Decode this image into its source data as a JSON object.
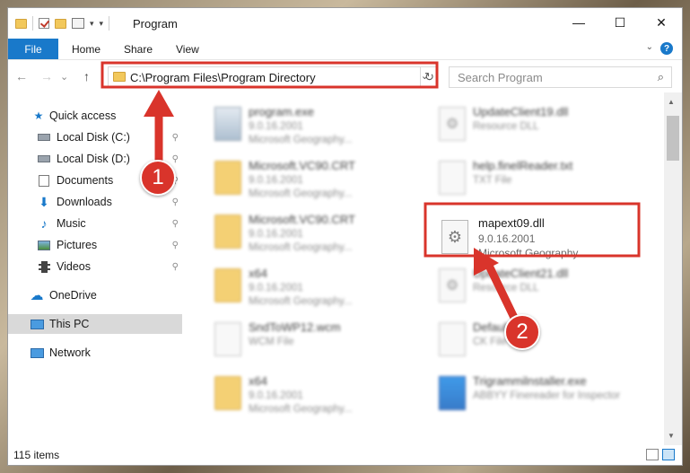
{
  "window": {
    "title": "Program",
    "controls": {
      "minimize": "—",
      "maximize": "☐",
      "close": "✕"
    }
  },
  "ribbon": {
    "tabs": [
      "File",
      "Home",
      "Share",
      "View"
    ],
    "expand_glyph": "⌄",
    "help_glyph": "?"
  },
  "navigation": {
    "back": "←",
    "forward": "→",
    "up": "↑",
    "address_path": "C:\\Program Files\\Program Directory",
    "dropdown_glyph": "⌄",
    "refresh_glyph": "↻",
    "search_placeholder": "Search Program",
    "search_glyph": "⌕"
  },
  "sidebar": {
    "items": [
      {
        "label": "Quick access",
        "icon": "star-icon",
        "pinned": false
      },
      {
        "label": "Local Disk (C:)",
        "icon": "drive-icon",
        "pinned": true
      },
      {
        "label": "Local Disk (D:)",
        "icon": "drive-icon",
        "pinned": true
      },
      {
        "label": "Documents",
        "icon": "documents-icon",
        "pinned": true
      },
      {
        "label": "Downloads",
        "icon": "downloads-icon",
        "pinned": true
      },
      {
        "label": "Music",
        "icon": "music-icon",
        "pinned": true
      },
      {
        "label": "Pictures",
        "icon": "pictures-icon",
        "pinned": true
      },
      {
        "label": "Videos",
        "icon": "videos-icon",
        "pinned": true
      },
      {
        "label": "OneDrive",
        "icon": "cloud-icon",
        "pinned": false
      },
      {
        "label": "This PC",
        "icon": "computer-icon",
        "pinned": false,
        "selected": true
      },
      {
        "label": "Network",
        "icon": "network-icon",
        "pinned": false
      }
    ],
    "pin_glyph": "📌"
  },
  "files": {
    "left_column": [
      {
        "name": "program.exe",
        "line2": "9.0.16.2001",
        "line3": "Microsoft Geography...",
        "icon": "exe"
      },
      {
        "name": "Microsoft.VC90.CRT",
        "line2": "9.0.16.2001",
        "line3": "Microsoft Geography...",
        "icon": "folder"
      },
      {
        "name": "Microsoft.VC90.CRT",
        "line2": "9.0.16.2001",
        "line3": "Microsoft Geography...",
        "icon": "folder"
      },
      {
        "name": "x64",
        "line2": "9.0.16.2001",
        "line3": "Microsoft Geography...",
        "icon": "folder"
      },
      {
        "name": "SndToWP12.wcm",
        "line2": "WCM File",
        "line3": "",
        "icon": "doc"
      },
      {
        "name": "x64",
        "line2": "9.0.16.2001",
        "line3": "Microsoft Geography...",
        "icon": "folder"
      }
    ],
    "right_column": [
      {
        "name": "UpdateClient19.dll",
        "line2": "Resource DLL",
        "line3": "",
        "icon": "dll"
      },
      {
        "name": "help.finelReader.txt",
        "line2": "TXT File",
        "line3": "",
        "icon": "doc"
      },
      {
        "name": "UpdateClient21.dll",
        "line2": "Resource DLL",
        "line3": "",
        "icon": "dll"
      },
      {
        "name": "Default.ck",
        "line2": "CK File",
        "line3": "",
        "icon": "doc"
      },
      {
        "name": "Trigrammilnstaller.exe",
        "line2": "ABBYY Finereader for Inspector",
        "line3": "",
        "icon": "exe-blue"
      }
    ],
    "highlighted": {
      "name": "mapext09.dll",
      "line2": "9.0.16.2001",
      "line3": "Microsoft Geography...",
      "icon": "dll"
    }
  },
  "status": {
    "items_count": "115 items"
  },
  "annotations": {
    "badge_1": "1",
    "badge_2": "2",
    "color": "#d9342b"
  }
}
